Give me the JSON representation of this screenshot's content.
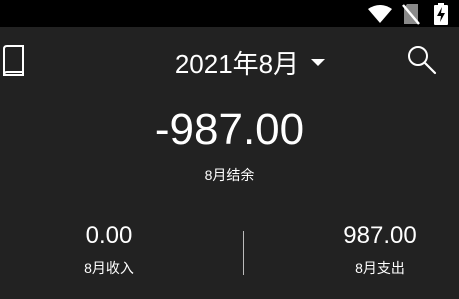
{
  "status_bar": {
    "icons": [
      "wifi-icon",
      "no-sim-icon",
      "battery-charging-icon"
    ]
  },
  "header": {
    "book_icon": "book-icon",
    "month_label": "2021年8月",
    "dropdown_icon": "dropdown-caret-icon",
    "search_icon": "search-icon"
  },
  "summary": {
    "balance_value": "-987.00",
    "balance_label": "8月结余",
    "income_value": "0.00",
    "income_label": "8月收入",
    "expense_value": "987.00",
    "expense_label": "8月支出"
  },
  "colors": {
    "background": "#222222",
    "status_bar": "#000000",
    "text": "#ffffff"
  }
}
